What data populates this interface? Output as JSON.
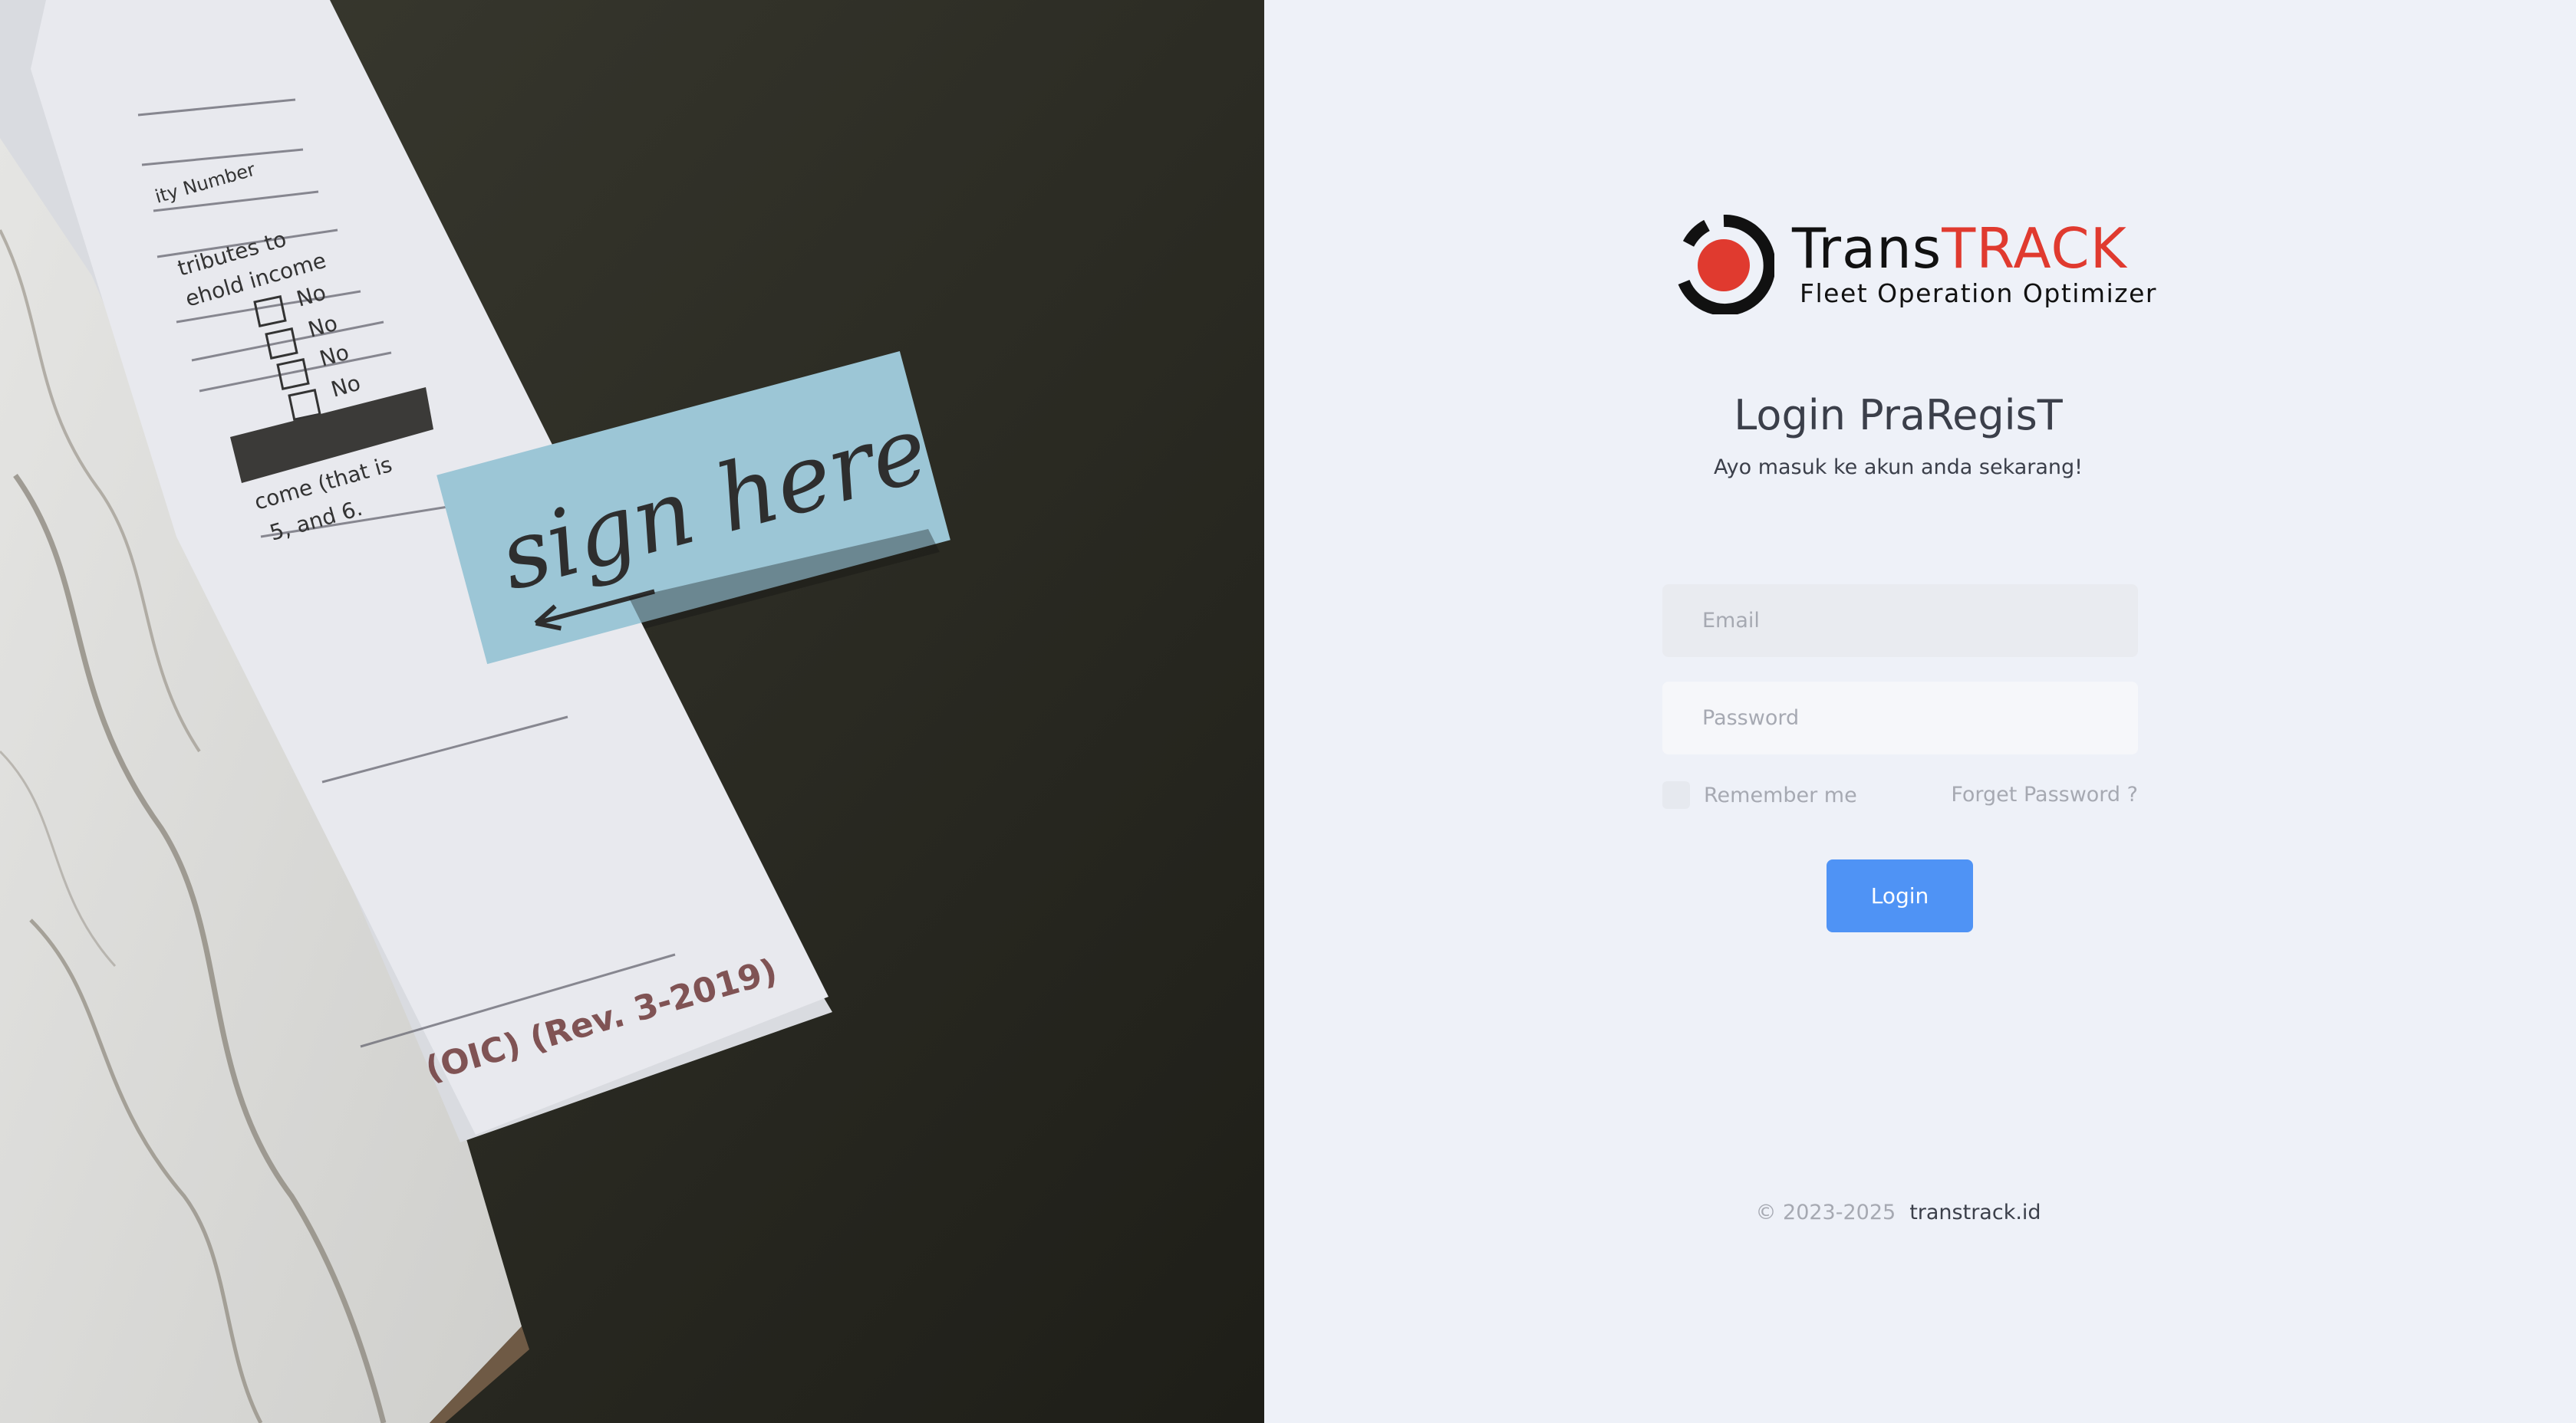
{
  "photo": {
    "note_text": "sign here",
    "form_texts": [
      "No",
      "No",
      "No",
      "No",
      "come (that is",
      "5, and 6.",
      "(OIC) (Rev. 3-2019)",
      "tributes to",
      "ehold income",
      "ity Number"
    ]
  },
  "brand": {
    "name_part1": "Trans",
    "name_part2": "TRACK",
    "tagline": "Fleet Operation Optimizer",
    "accent_color": "#e03a2f",
    "dark_color": "#111111"
  },
  "login": {
    "title": "Login PraRegisT",
    "subtitle": "Ayo masuk ke akun anda sekarang!",
    "email_placeholder": "Email",
    "password_placeholder": "Password",
    "remember_label": "Remember me",
    "forgot_label": "Forget Password ?",
    "button_label": "Login",
    "button_color": "#4f93f5"
  },
  "footer": {
    "copyright": "© 2023-2025",
    "site": "transtrack.id"
  }
}
